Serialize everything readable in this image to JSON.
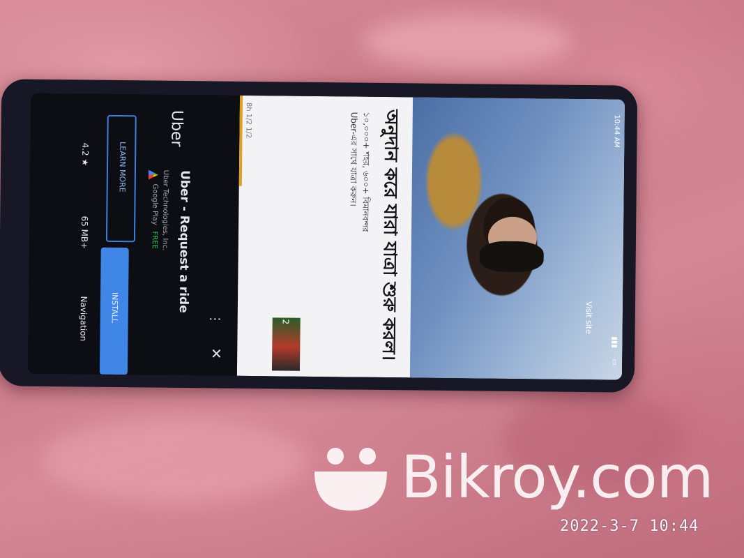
{
  "ad": {
    "app_name": "Uber",
    "title": "Uber - Request a ride",
    "developer": "Uber Technologies, Inc.",
    "store": "Google Play",
    "price": "FREE",
    "learn_more_label": "LEARN MORE",
    "install_label": "INSTALL",
    "rating": "4.2 ★",
    "size": "65 MB+",
    "category": "Navigation"
  },
  "article": {
    "headline": "অনুদান করে যারা যাত্রা শুরু করল।",
    "subtext_1": "১০,০০০+ শহর, ৬০০+ বিমানবন্দর",
    "subtext_2": "Uber-এর সাথে যাত্রা করুন।",
    "meta": "8h 1/2 1/2",
    "overlay_text": "Visit site",
    "thumb_number": "2"
  },
  "status_bar": {
    "time": "10:44 AM"
  },
  "watermark": {
    "brand": "Bikroy.com"
  },
  "timestamp": "2022-3-7 10:44",
  "colors": {
    "accent_blue": "#3f86e6",
    "fabric": "#d48896"
  }
}
